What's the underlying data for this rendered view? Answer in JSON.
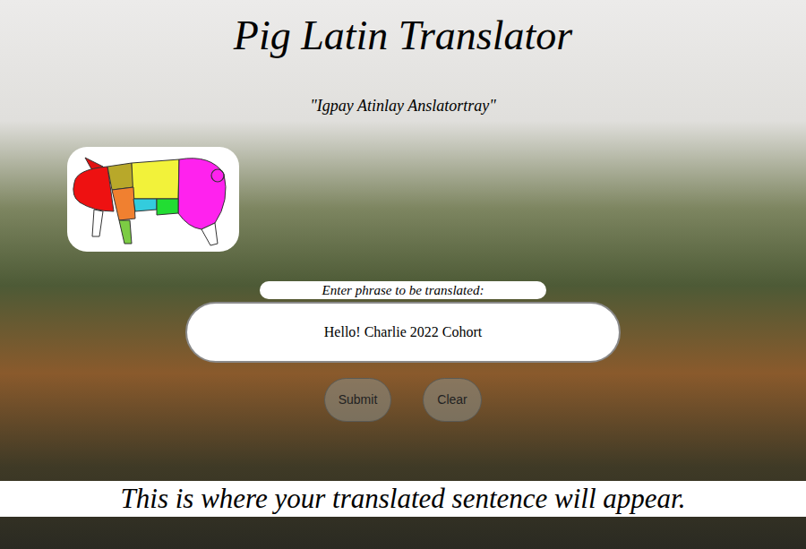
{
  "title": "Pig Latin Translator",
  "subtitle": "\"Igpay Atinlay Anslatortray\"",
  "input": {
    "label": "Enter phrase to be translated:",
    "value": "Hello! Charlie 2022 Cohort"
  },
  "buttons": [
    "Submit",
    "Clear"
  ],
  "output": "This is where your translated sentence will appear."
}
